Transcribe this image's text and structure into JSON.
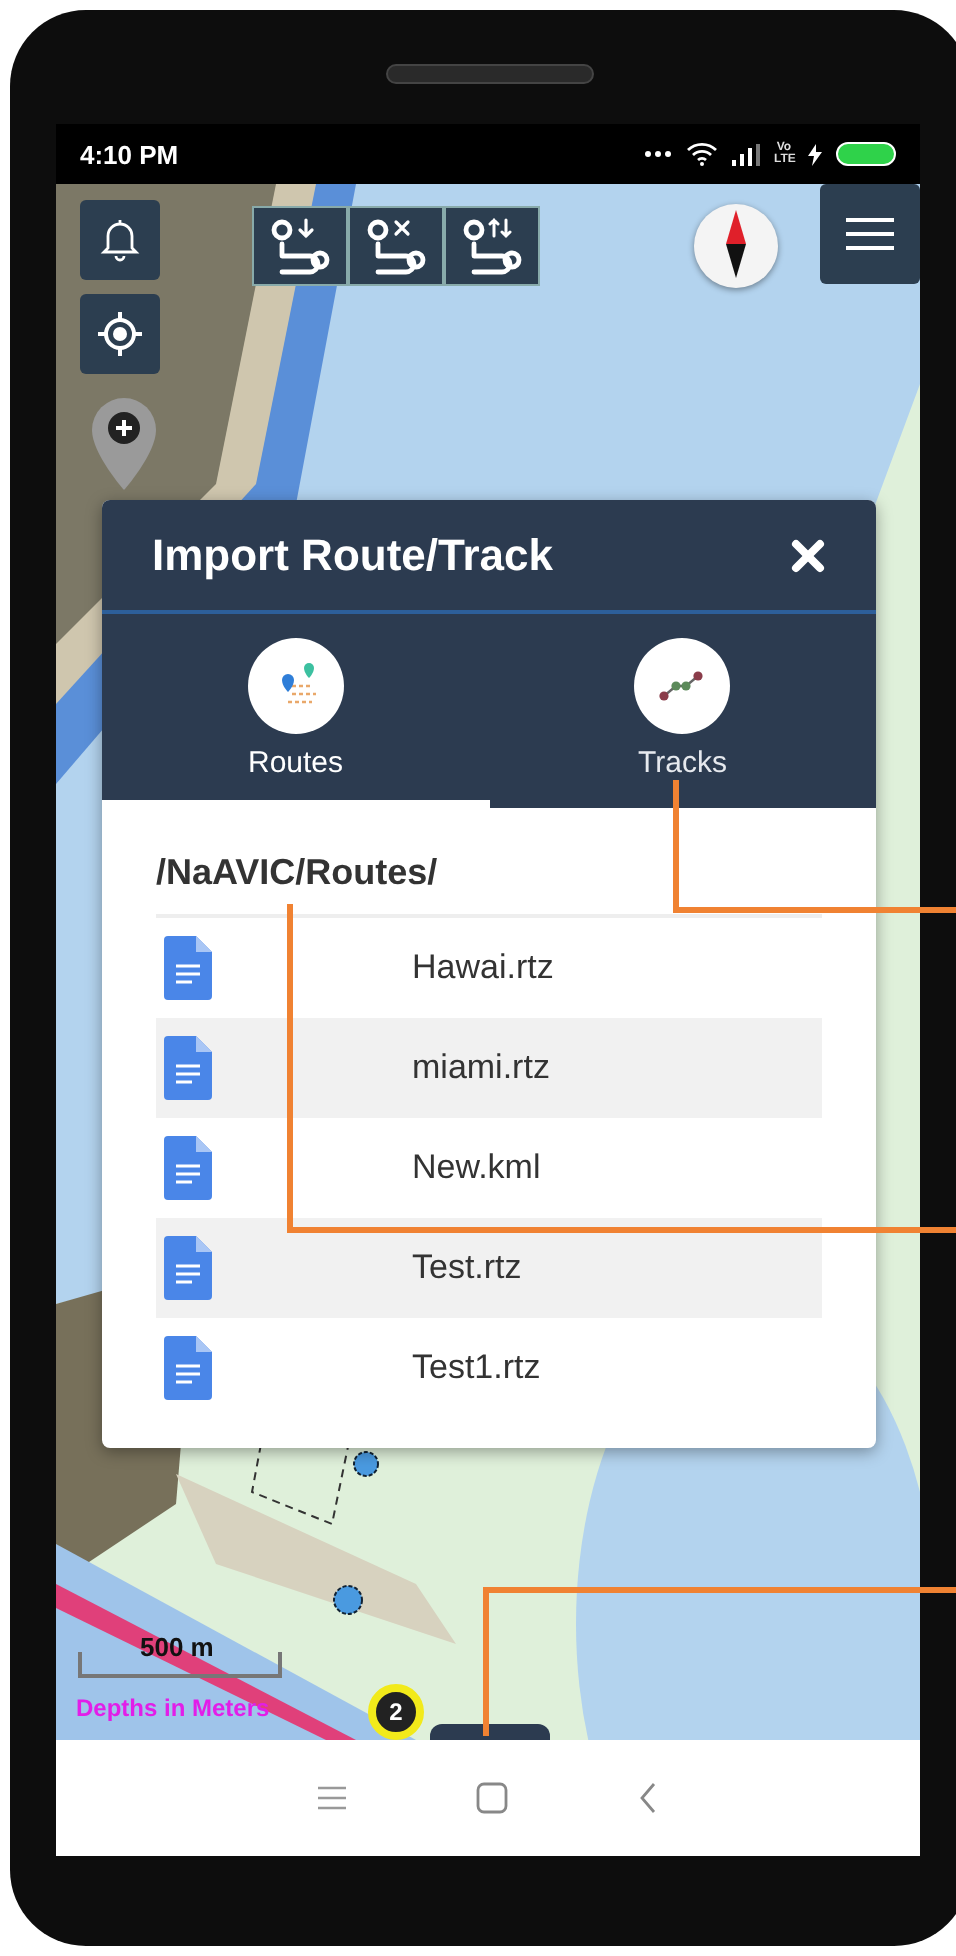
{
  "status_bar": {
    "time": "4:10 PM",
    "network_label": "Vo LTE"
  },
  "dialog": {
    "title": "Import Route/Track",
    "tabs": [
      {
        "label": "Routes",
        "kind": "routes",
        "selected": true
      },
      {
        "label": "Tracks",
        "kind": "tracks",
        "selected": false
      }
    ],
    "path": "/NaAVIC/Routes/",
    "files": [
      {
        "name": "Hawai.rtz"
      },
      {
        "name": "miami.rtz"
      },
      {
        "name": "New.kml"
      },
      {
        "name": "Test.rtz"
      },
      {
        "name": "Test1.rtz"
      }
    ]
  },
  "map": {
    "scale": "500 m",
    "depth_label": "Depths in Meters",
    "cluster_count": "2"
  }
}
